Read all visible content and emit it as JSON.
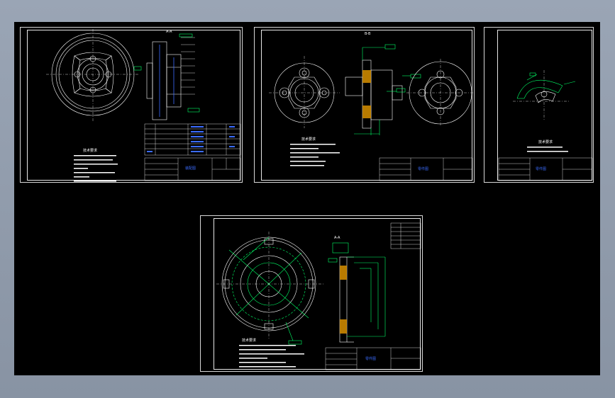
{
  "viewer": {
    "background_color": "#000000",
    "chrome_color": "#8f9aab"
  },
  "sheets": [
    {
      "id": "sheet-1",
      "section_label": "A-A",
      "tech_title": "技术要求",
      "title_block_label": "装配图"
    },
    {
      "id": "sheet-2",
      "section_label": "B-B",
      "tech_title": "技术要求",
      "title_block_label": "零件图"
    },
    {
      "id": "sheet-3",
      "section_label": "",
      "tech_title": "技术要求",
      "title_block_label": "零件图"
    },
    {
      "id": "sheet-4",
      "section_label": "A-A",
      "tech_title": "技术要求",
      "title_block_label": "零件图"
    }
  ]
}
